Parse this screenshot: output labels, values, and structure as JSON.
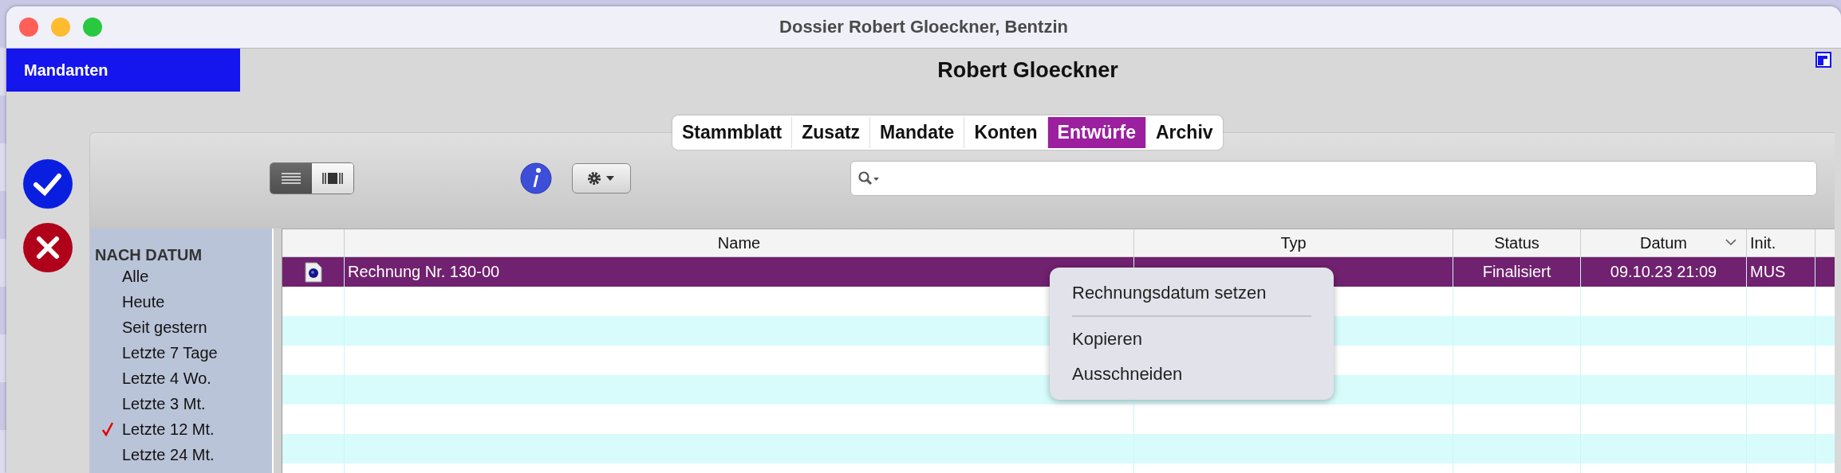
{
  "window": {
    "title": "Dossier Robert Gloeckner, Bentzin"
  },
  "sidebar_tab": {
    "label": "Mandanten"
  },
  "header": {
    "title": "Robert Gloeckner"
  },
  "tabs": [
    {
      "label": "Stammblatt",
      "selected": false
    },
    {
      "label": "Zusatz",
      "selected": false
    },
    {
      "label": "Mandate",
      "selected": false
    },
    {
      "label": "Konten",
      "selected": false
    },
    {
      "label": "Entwürfe",
      "selected": true
    },
    {
      "label": "Archiv",
      "selected": false
    }
  ],
  "view_toggle": [
    {
      "kind": "list",
      "selected": true
    },
    {
      "kind": "columns",
      "selected": false
    }
  ],
  "filter": {
    "heading": "NACH DATUM",
    "items": [
      {
        "label": "Alle",
        "checked": false
      },
      {
        "label": "Heute",
        "checked": false
      },
      {
        "label": "Seit gestern",
        "checked": false
      },
      {
        "label": "Letzte 7 Tage",
        "checked": false
      },
      {
        "label": "Letzte 4 Wo.",
        "checked": false
      },
      {
        "label": "Letzte 3 Mt.",
        "checked": false
      },
      {
        "label": "Letzte 12 Mt.",
        "checked": true
      },
      {
        "label": "Letzte 24 Mt.",
        "checked": false
      }
    ]
  },
  "table": {
    "columns": [
      {
        "label": "Name",
        "sorted": false
      },
      {
        "label": "Typ",
        "sorted": false
      },
      {
        "label": "Status",
        "sorted": false
      },
      {
        "label": "Datum",
        "sorted": true
      },
      {
        "label": "Init.",
        "sorted": false
      }
    ],
    "rows": [
      {
        "name": "Rechnung Nr. 130-00",
        "status": "Finalisiert",
        "datum": "09.10.23 21:09",
        "init": "MUS",
        "selected": true
      }
    ]
  },
  "context_menu": {
    "items": [
      {
        "kind": "item",
        "label": "Rechnungsdatum setzen"
      },
      {
        "kind": "separator"
      },
      {
        "kind": "item",
        "label": "Kopieren"
      },
      {
        "kind": "item",
        "label": "Ausschneiden"
      }
    ]
  }
}
